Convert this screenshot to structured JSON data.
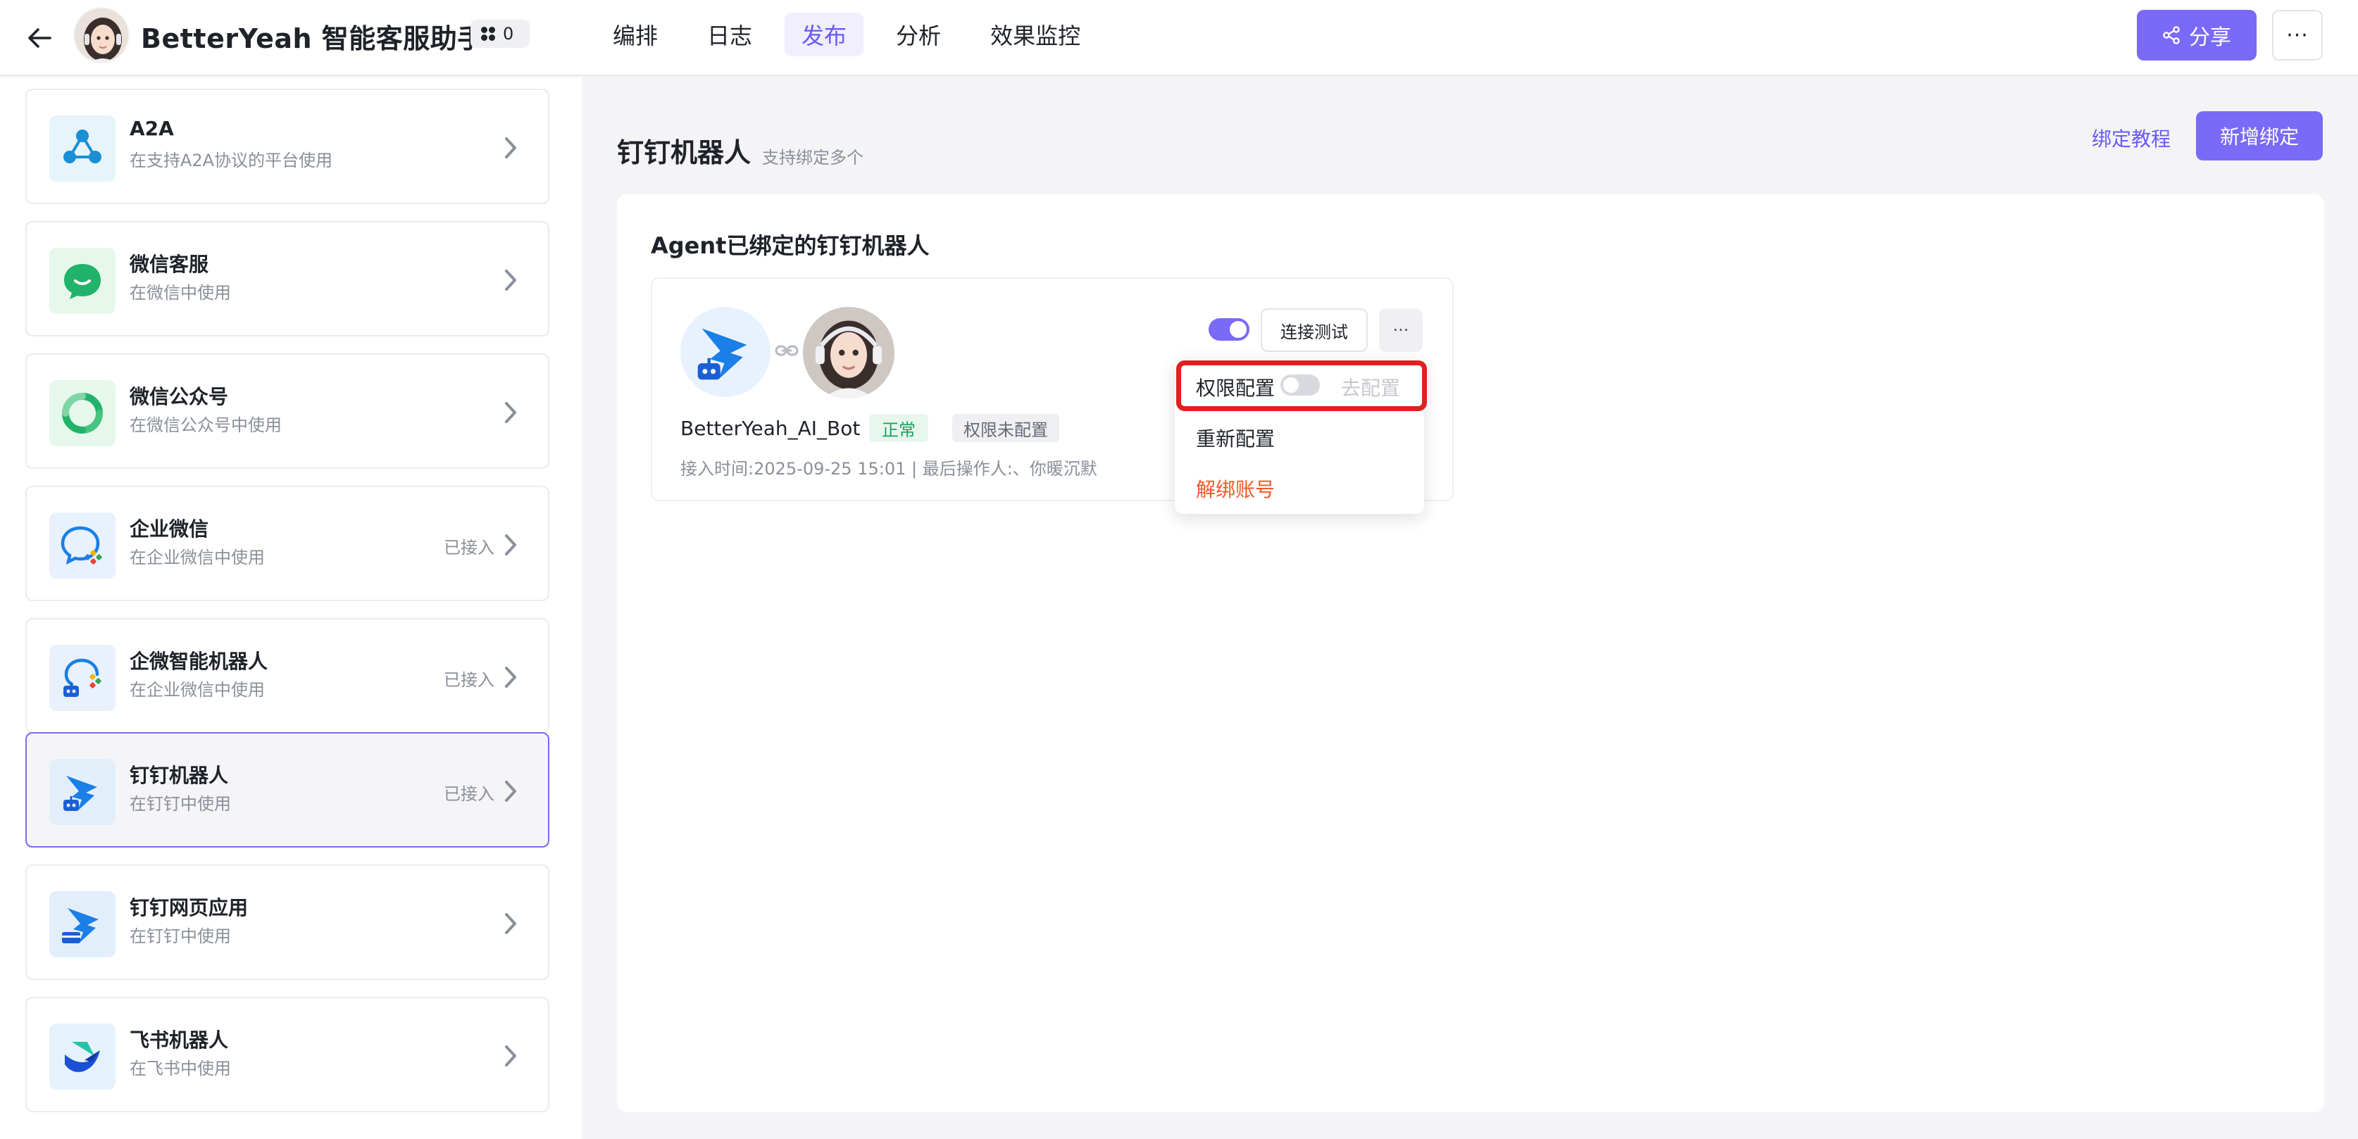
{
  "header": {
    "app_title": "BetterYeah 智能客服助手",
    "badge_count": "0",
    "tabs": [
      {
        "label": "编排",
        "active": false
      },
      {
        "label": "日志",
        "active": false
      },
      {
        "label": "发布",
        "active": true
      },
      {
        "label": "分析",
        "active": false
      },
      {
        "label": "效果监控",
        "active": false
      }
    ],
    "share_label": "分享",
    "more_label": "···"
  },
  "sidebar": {
    "items": [
      {
        "name": "A2A",
        "desc": "在支持A2A协议的平台使用",
        "status": "",
        "icon": "a2a-icon"
      },
      {
        "name": "微信客服",
        "desc": "在微信中使用",
        "status": "",
        "icon": "wechat-service-icon"
      },
      {
        "name": "微信公众号",
        "desc": "在微信公众号中使用",
        "status": "",
        "icon": "wechat-official-icon"
      },
      {
        "name": "企业微信",
        "desc": "在企业微信中使用",
        "status": "已接入",
        "icon": "wecom-icon"
      },
      {
        "name": "企微智能机器人",
        "desc": "在企业微信中使用",
        "status": "已接入",
        "icon": "wecom-bot-icon"
      },
      {
        "name": "钉钉机器人",
        "desc": "在钉钉中使用",
        "status": "已接入",
        "icon": "dingtalk-bot-icon",
        "active": true
      },
      {
        "name": "钉钉网页应用",
        "desc": "在钉钉中使用",
        "status": "",
        "icon": "dingtalk-web-icon"
      },
      {
        "name": "飞书机器人",
        "desc": "在飞书中使用",
        "status": "",
        "icon": "feishu-bot-icon"
      }
    ]
  },
  "main": {
    "title": "钉钉机器人",
    "subtitle": "支持绑定多个",
    "tutorial_link": "绑定教程",
    "add_button": "新增绑定",
    "panel_heading": "Agent已绑定的钉钉机器人",
    "bot": {
      "name": "BetterYeah_AI_Bot",
      "status_tag": "正常",
      "perm_tag": "权限未配置",
      "meta": "接入时间:2025-09-25 15:01 | 最后操作人:、你暖沉默",
      "enabled": true,
      "connect_test": "连接测试",
      "more": "···"
    },
    "dropdown": {
      "perm_label": "权限配置",
      "perm_enabled": false,
      "perm_link": "去配置",
      "reconfigure": "重新配置",
      "unbind": "解绑账号"
    }
  },
  "colors": {
    "accent": "#7a6af7",
    "accent_text": "#6a5af9",
    "success": "#16a35b",
    "danger": "#f5562a",
    "highlight": "#e02020"
  }
}
